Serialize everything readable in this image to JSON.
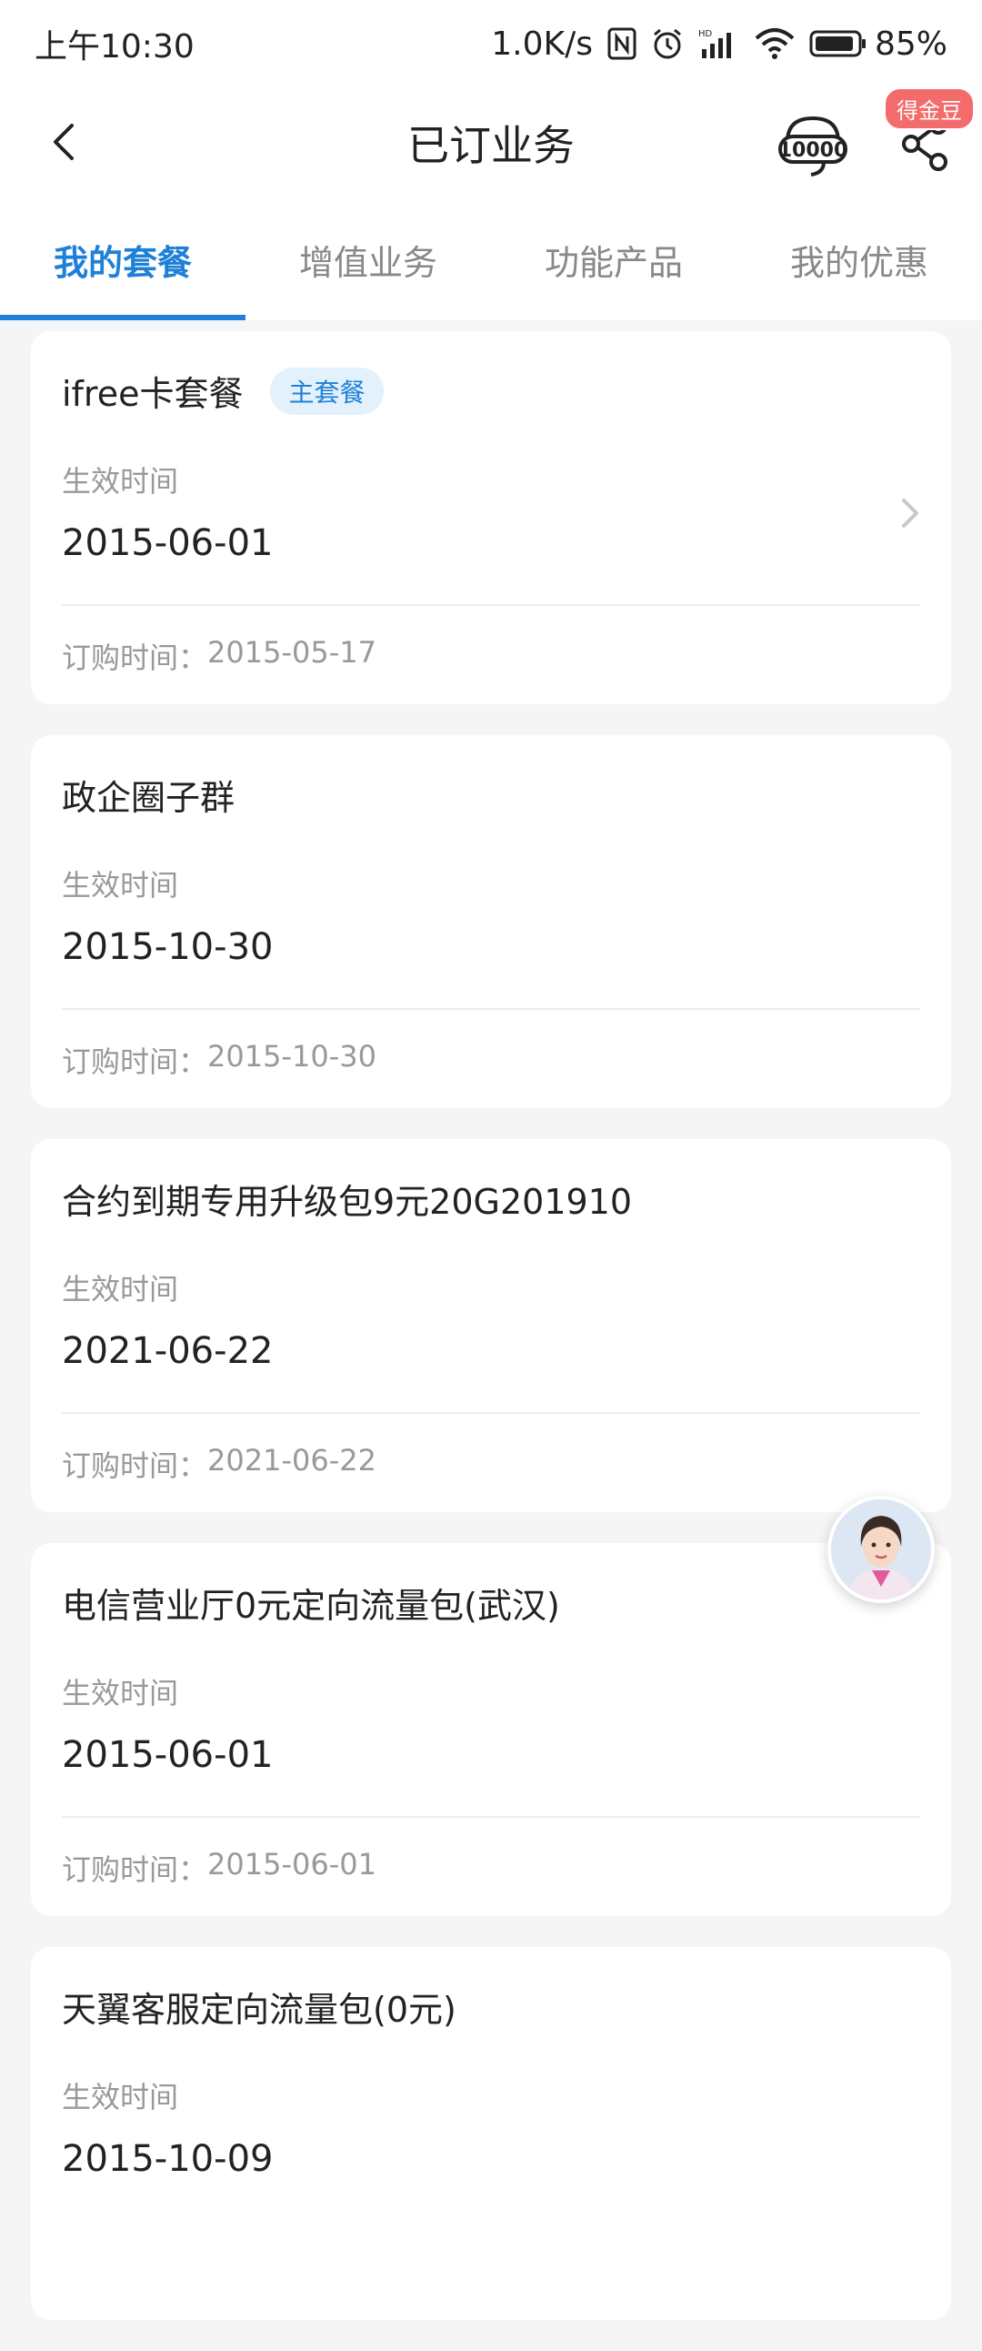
{
  "status_bar": {
    "time": "上午10:30",
    "network_speed": "1.0K/s",
    "battery": "85%",
    "icons": [
      "nfc-icon",
      "alarm-icon",
      "signal-icon",
      "wifi-icon",
      "battery-icon"
    ]
  },
  "header": {
    "title": "已订业务",
    "reward_badge": "得金豆",
    "service_icon": "10000",
    "icons": [
      "back-icon",
      "customer-service-icon",
      "share-icon"
    ]
  },
  "tabs": [
    {
      "label": "我的套餐",
      "active": true
    },
    {
      "label": "增值业务",
      "active": false
    },
    {
      "label": "功能产品",
      "active": false
    },
    {
      "label": "我的优惠",
      "active": false
    }
  ],
  "colors": {
    "accent": "#1f80d8",
    "badge_bg": "#e3f1fc",
    "reward": "#f46b6b",
    "page_bg": "#f5f5f5"
  },
  "cards": [
    {
      "title": "ifree卡套餐",
      "badge": "主套餐",
      "effective_label": "生效时间",
      "effective_date": "2015-06-01",
      "order_label": "订购时间：",
      "order_date": "2015-05-17"
    },
    {
      "title": "政企圈子群",
      "effective_label": "生效时间",
      "effective_date": "2015-10-30",
      "order_label": "订购时间：",
      "order_date": "2015-10-30"
    },
    {
      "title": "合约到期专用升级包9元20G201910",
      "effective_label": "生效时间",
      "effective_date": "2021-06-22",
      "order_label": "订购时间：",
      "order_date": "2021-06-22"
    },
    {
      "title": "电信营业厅0元定向流量包(武汉)",
      "effective_label": "生效时间",
      "effective_date": "2015-06-01",
      "order_label": "订购时间：",
      "order_date": "2015-06-01"
    },
    {
      "title": "天翼客服定向流量包(0元)",
      "effective_label": "生效时间",
      "effective_date": "2015-10-09",
      "order_label": "",
      "order_date": ""
    }
  ]
}
